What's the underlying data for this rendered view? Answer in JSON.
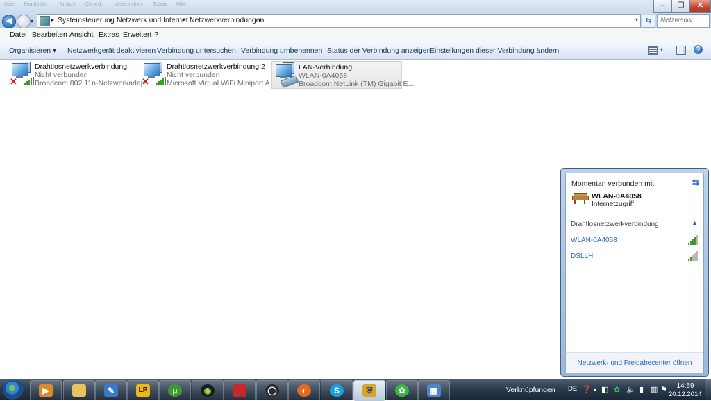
{
  "window": {
    "ghost_menu": [
      "Datei",
      "Bearbeiten",
      "Ansicht",
      "Chronik",
      "Lesezeichen",
      "Extras",
      "Hilfe"
    ],
    "controls": {
      "minimize": "–",
      "maximize": "❐",
      "close": "✕"
    }
  },
  "address": {
    "breadcrumb": [
      "Systemsteuerung",
      "Netzwerk und Internet",
      "Netzwerkverbindungen"
    ],
    "separator": "▸",
    "search_placeholder": "Netzwerkv..."
  },
  "menu": [
    "Datei",
    "Bearbeiten",
    "Ansicht",
    "Extras",
    "Erweitert",
    "?"
  ],
  "commands": [
    "Organisieren ▾",
    "Netzwerkgerät deaktivieren",
    "Verbindung untersuchen",
    "Verbindung umbenennen",
    "Status der Verbindung anzeigen",
    "Einstellungen dieser Verbindung ändern"
  ],
  "connections": [
    {
      "name": "Drahtlosnetzwerkverbindung",
      "status": "Nicht verbunden",
      "device": "Broadcom 802.11n-Netzwerkadap...",
      "icon": "wireless-disconnected-icon"
    },
    {
      "name": "Drahtlosnetzwerkverbindung 2",
      "status": "Nicht verbunden",
      "device": "Microsoft Virtual WiFi Miniport A...",
      "icon": "wireless-disconnected-icon"
    },
    {
      "name": "LAN-Verbindung",
      "status": "WLAN-0A4058",
      "device": "Broadcom NetLink (TM) Gigabit E...",
      "icon": "lan-connected-icon"
    }
  ],
  "flyout": {
    "header": "Momentan verbunden mit:",
    "current_network": "WLAN-0A4058",
    "current_access": "Internetzugriff",
    "section": "Drahtlosnetzwerkverbindung",
    "networks": [
      {
        "name": "WLAN-0A4058",
        "signal_bars": 4
      },
      {
        "name": "DSLLH",
        "signal_bars": 2
      }
    ],
    "footer_link": "Netzwerk- und Freigabecenter öffnen"
  },
  "taskbar": {
    "apps": [
      "media-player-icon",
      "explorer-icon",
      "paint-icon",
      "lastpass-icon",
      "utorrent-icon",
      "app-icon",
      "notebook-icon",
      "search-app-icon",
      "firefox-icon",
      "skype-icon",
      "security-icon",
      "icq-icon",
      "control-panel-icon"
    ],
    "toolbar_label": "Verknüpfungen",
    "language": "DE",
    "time": "14:59",
    "date": "20.12.2014"
  },
  "colors": {
    "accent": "#2a66bf",
    "signal": "#3c9b2c",
    "error": "#d21a1a"
  }
}
